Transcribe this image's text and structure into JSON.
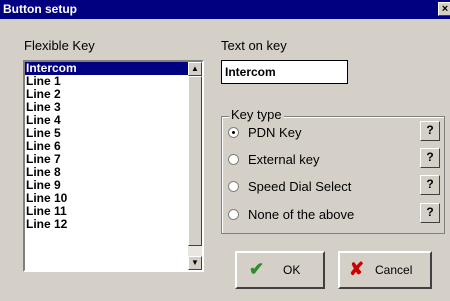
{
  "window": {
    "title": "Button setup",
    "close_glyph": "×"
  },
  "flexible_key": {
    "label": "Flexible Key",
    "items": [
      "Intercom",
      "Line 1",
      "Line 2",
      "Line 3",
      "Line 4",
      "Line 5",
      "Line 6",
      "Line 7",
      "Line 8",
      "Line 9",
      "Line 10",
      "Line 11",
      "Line 12"
    ],
    "selected_index": 0
  },
  "text_on_key": {
    "label": "Text on key",
    "value": "Intercom"
  },
  "key_type": {
    "legend": "Key type",
    "options": [
      {
        "label": "PDN Key",
        "selected": true,
        "help": "?"
      },
      {
        "label": "External key",
        "selected": false,
        "help": "?"
      },
      {
        "label": "Speed Dial Select",
        "selected": false,
        "help": "?"
      },
      {
        "label": "None of the above",
        "selected": false,
        "help": "?"
      }
    ]
  },
  "buttons": {
    "ok": {
      "label": "OK",
      "icon": "checkmark-icon",
      "icon_color": "#2e8b2e"
    },
    "cancel": {
      "label": "Cancel",
      "icon": "x-icon",
      "icon_color": "#cc0000"
    }
  }
}
